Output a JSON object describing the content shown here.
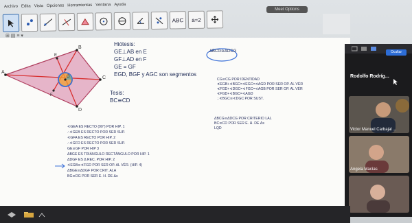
{
  "menu": {
    "items": [
      "Archivo",
      "Edita",
      "Vista",
      "Opciones",
      "Herramientas",
      "Ventana",
      "Ayuda"
    ]
  },
  "window_pill": "Meet Options",
  "toolbar": {
    "tools": [
      {
        "icon": "pointer-icon"
      },
      {
        "icon": "point-icon"
      },
      {
        "icon": "line-icon"
      },
      {
        "icon": "perpendicular-icon"
      },
      {
        "icon": "polygon-icon"
      },
      {
        "icon": "circle-icon"
      },
      {
        "icon": "conic-icon"
      },
      {
        "icon": "angle-icon"
      },
      {
        "icon": "reflect-icon"
      },
      {
        "label": "ABC"
      },
      {
        "label": "a=2"
      },
      {
        "icon": "move-view-icon"
      }
    ]
  },
  "figure": {
    "labels": {
      "A": "A",
      "B": "B",
      "C": "C",
      "D": "D",
      "E": "E",
      "F": "F",
      "G": "G"
    },
    "colors": {
      "fill": "#e8b8cc",
      "stroke": "#b04060",
      "line": "#d83030",
      "circle": "#3a6fd8",
      "orange": "#f0a030"
    }
  },
  "hypothesis": {
    "title": "Hiótesis:",
    "lines": [
      "GE⊥AB en E",
      "GF⊥AD en F",
      "GE = GF",
      "EGD, BGF y AGC son segmentos"
    ]
  },
  "thesis": {
    "title": "Tesis:",
    "line": "BC≅CD"
  },
  "circled_note": "ΔBCG≅ΔDCG",
  "proof_left": [
    "∢GEA ES RECTO (90°) POR HIP. 1",
    "∴∢GEB ES RECTO POR SER SUP.",
    "∢GFA ES RECTO POR HIP. 2",
    "∴∢GFD ES RECTO POR SER SUP.",
    "GE≅GF POR HIP 3",
    "ΔBGE ES TRIÁNGULO RECTÁNGULO POR HIP. 1",
    "ΔDGF ES Δ REC. POR HIP. 2",
    "∢EGB≅∢FGD POR SER OP. AL VÉR. (HIP. 4)",
    "ΔBGE≅ΔDGF POR CRIT. ALA",
    "BG≅DG POR SER E. H. DE Δs"
  ],
  "proof_right": [
    "CG≅CG POR IDENTIDAD",
    "∢EGB+∢BGC=∢EGC=∢AGD POR SER OP. AL VÉR",
    "∢FGD+∢DGC=∢FGC=∢AGB POR SER OP. AL VÉR",
    "∢FGD+∢BGC=∢AGD",
    "∴∢BGC≅∢DGC POR SUST."
  ],
  "proof_right2": [
    "ΔBCG≅ΔDCG POR CRITERIO LAL",
    "BC≅CD POR SER E. H. DE Δs",
    "LQD"
  ],
  "meeting": {
    "button": "Ocultar",
    "host": "Rodolfo Rodríg...",
    "participants": [
      {
        "name": "Victor Manuel Carbajal ..."
      },
      {
        "name": "Angela Macías"
      },
      {
        "name": ""
      }
    ]
  },
  "subbar": "⊞ ▤ ≡ ▾"
}
